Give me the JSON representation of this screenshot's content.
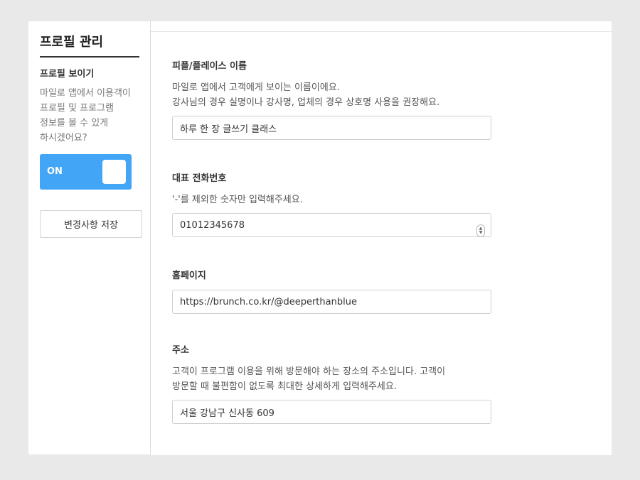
{
  "sidebar": {
    "title": "프로필 관리",
    "section_label": "프로필 보이기",
    "description_lines": [
      "마일로 앱에서 이용객이",
      "프로필 및 프로그램",
      "정보를 볼 수 있게",
      "하시겠어요?"
    ],
    "toggle_label": "ON",
    "toggle_state": true,
    "save_label": "변경사항 저장"
  },
  "fields": {
    "name": {
      "label": "피플/플레이스 이름",
      "desc_lines": [
        "마일로 앱에서 고객에게 보이는 이름이에요.",
        "강사님의 경우 실명이나 강사명, 업체의 경우 상호명 사용을 권장해요."
      ],
      "value": "하루 한 장 글쓰기 클래스"
    },
    "phone": {
      "label": "대표 전화번호",
      "desc_lines": [
        "'-'를 제외한 숫자만 입력해주세요."
      ],
      "value": "01012345678"
    },
    "homepage": {
      "label": "홈페이지",
      "value": "https://brunch.co.kr/@deeperthanblue"
    },
    "address": {
      "label": "주소",
      "desc_lines": [
        "고객이 프로그램 이용을 위해 방문해야 하는 장소의 주소입니다. 고객이",
        "방문할 때 불편함이 없도록 최대한 상세하게 입력해주세요."
      ],
      "value": "서울 강남구 신사동 609"
    }
  },
  "colors": {
    "accent": "#42a5f5",
    "background": "#e9e9e9"
  }
}
